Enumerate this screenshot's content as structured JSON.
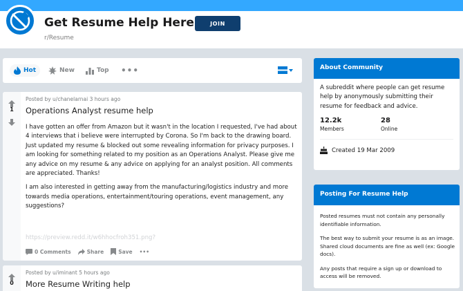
{
  "header": {
    "title": "Get Resume Help Here",
    "join_label": "JOIN",
    "subreddit": "r/Resume",
    "banner_color": "#33a8ff",
    "accent_color": "#0079d3",
    "join_color": "#0f3e6e"
  },
  "sortbar": {
    "hot": "Hot",
    "new": "New",
    "top": "Top",
    "more": "•••",
    "hot_icon": "flame-icon",
    "new_icon": "sunburst-icon",
    "top_icon": "bar-chart-icon",
    "view_icon": "card-view-icon"
  },
  "posts": [
    {
      "votes": "1",
      "meta": "Posted by u/chanelarnai 3 hours ago",
      "title": "Operations Analyst resume help",
      "body": [
        "I have gotten an offer from Amazon but it wasn't in the location I requested, I've had about 4 interviews that i believe were interrupted by Corona. So I'm back to the drawing board. Just updated my resume & blocked out some revealing information for privacy purposes. I am looking for something related to my position as an Operations Analyst. Please give me any advice on my resume & any advice on applying for an analyst position. All comments are appreciated. Thanks!",
        "I am also interested in getting away from the manufacturing/logistics industry and more towards media operations, entertainment/touring operations, event management, any suggestions?"
      ],
      "link": "https://preview.redd.it/w6hhocfroh351.png?",
      "actions": {
        "comments": "0 Comments",
        "share": "Share",
        "save": "Save",
        "more": "•••"
      }
    },
    {
      "votes": "0",
      "meta": "Posted by u/iminant 5 hours ago",
      "title": "More Resume Writing help"
    }
  ],
  "about": {
    "heading": "About Community",
    "description": "A subreddit where people can get resume help by anonymously submitting their resume for feedback and advice.",
    "members_value": "12.2k",
    "members_label": "Members",
    "online_value": "28",
    "online_label": "Online",
    "created": "Created 19 Mar 2009",
    "created_icon": "cake-icon"
  },
  "posting": {
    "heading": "Posting For Resume Help",
    "rules": [
      "Posted resumes must not contain any personally identifiable information.",
      "The best way to submit your resume is as an image. Shared cloud documents are fine as well (ex: Google docs).",
      "Any posts that require a sign up or download to access will be removed."
    ]
  }
}
